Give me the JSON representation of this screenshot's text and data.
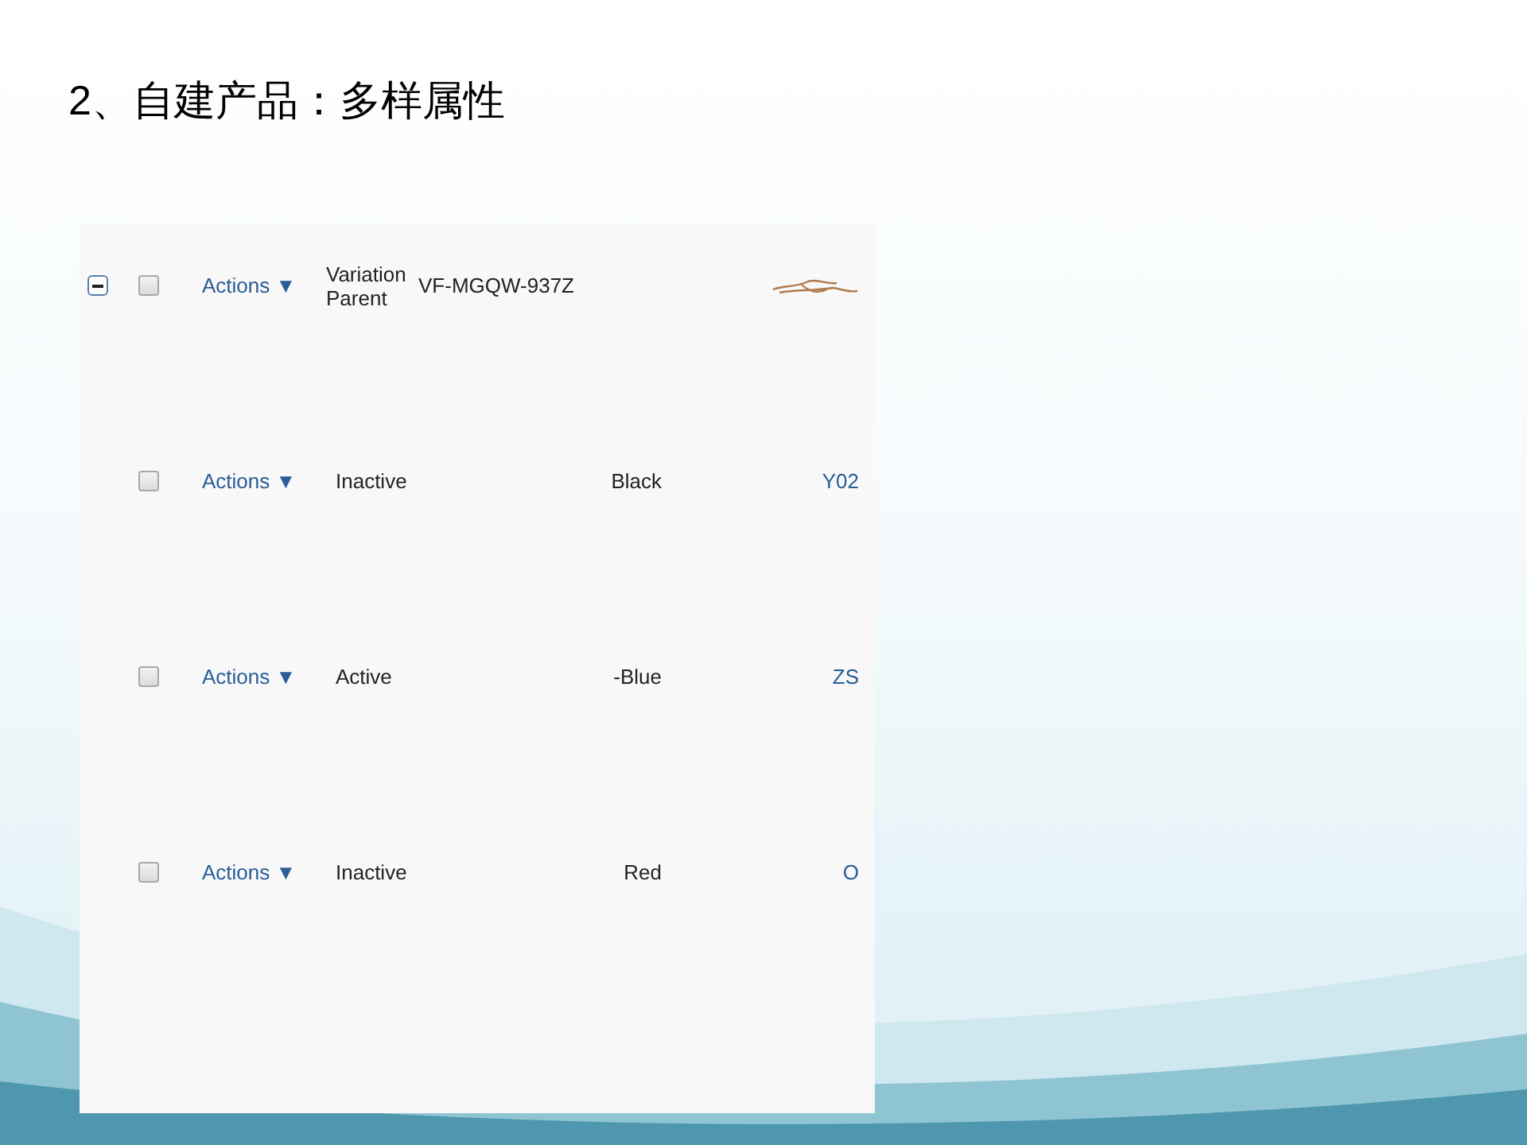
{
  "slide_title": "2、自建产品：多样属性",
  "rows": [
    {
      "kind": "parent",
      "expanded": true,
      "checked": false,
      "actions": "Actions ▼",
      "status": "Variation Parent",
      "sku": "VF-MGQW-937Z"
    },
    {
      "kind": "child",
      "checked": false,
      "actions": "Actions ▼",
      "status": "Inactive",
      "sku": "Black",
      "column_6": "Y02"
    },
    {
      "kind": "child",
      "checked": false,
      "actions": "Actions ▼",
      "status": "Active",
      "sku": "-Blue",
      "column_6": "ZS"
    },
    {
      "kind": "child",
      "checked": false,
      "actions": "Actions ▼",
      "status": "Inactive",
      "sku": "Red",
      "column_6": "O"
    }
  ]
}
